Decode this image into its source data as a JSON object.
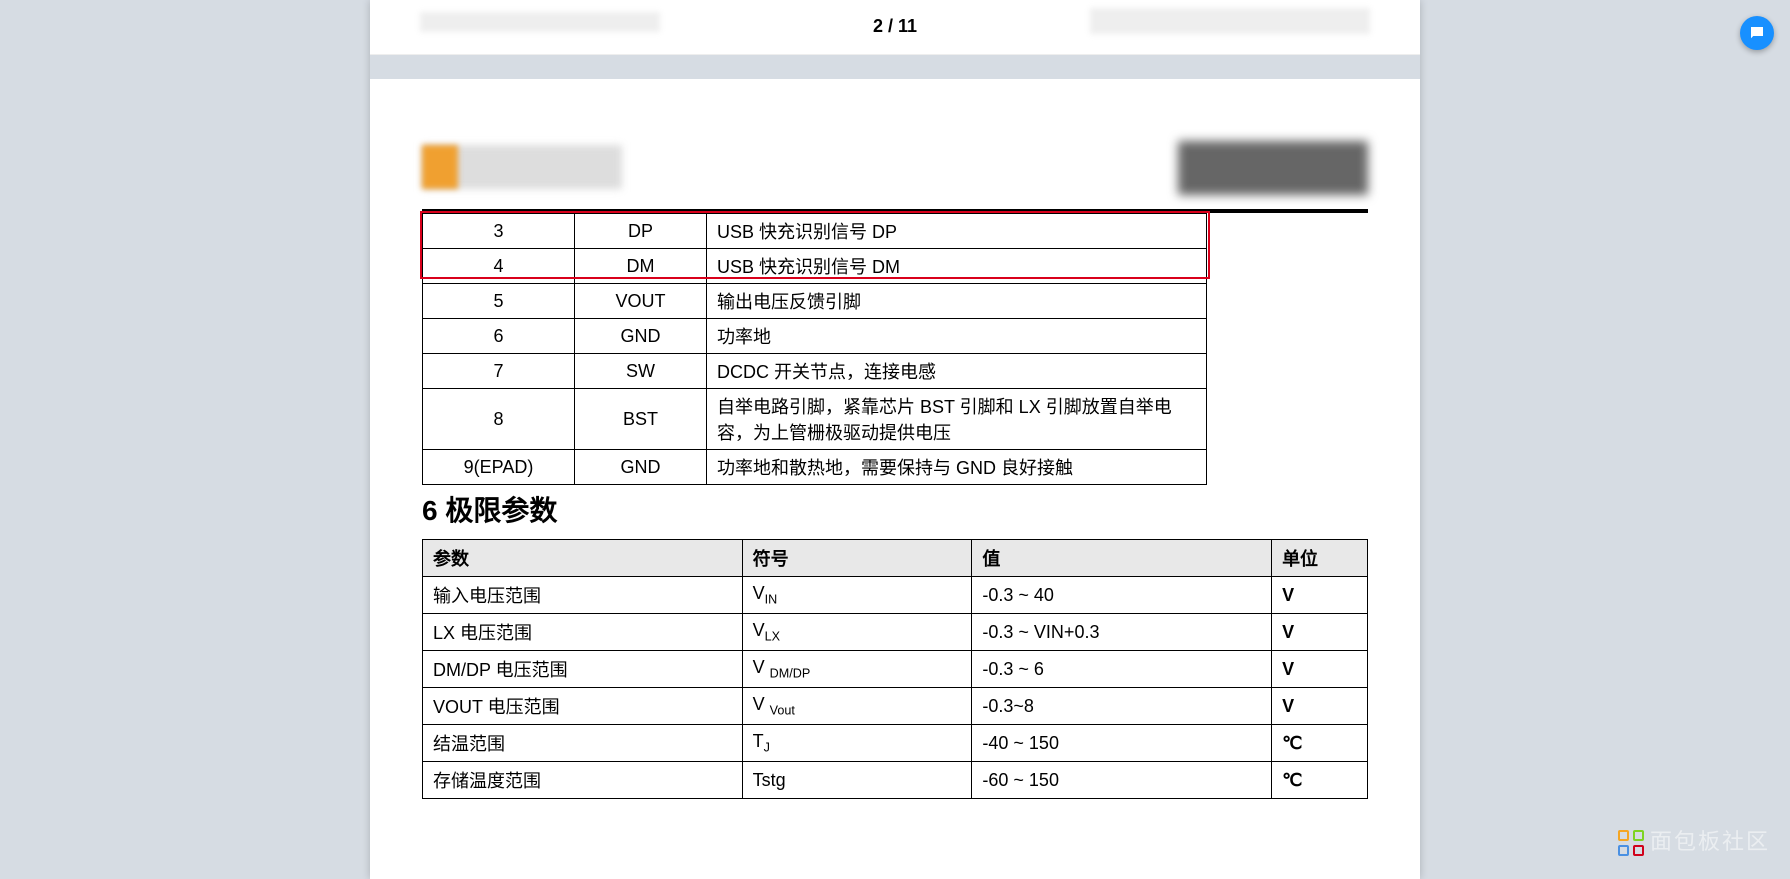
{
  "pager": "2 / 11",
  "pin_rows": [
    {
      "num": "3",
      "name": "DP",
      "desc": "USB 快充识别信号 DP"
    },
    {
      "num": "4",
      "name": "DM",
      "desc": "USB 快充识别信号 DM"
    },
    {
      "num": "5",
      "name": "VOUT",
      "desc": "输出电压反馈引脚"
    },
    {
      "num": "6",
      "name": "GND",
      "desc": "功率地"
    },
    {
      "num": "7",
      "name": "SW",
      "desc": "DCDC 开关节点，连接电感"
    },
    {
      "num": "8",
      "name": "BST",
      "desc": "自举电路引脚，紧靠芯片 BST 引脚和 LX 引脚放置自举电容，为上管栅极驱动提供电压"
    },
    {
      "num": "9(EPAD)",
      "name": "GND",
      "desc": "功率地和散热地，需要保持与 GND 良好接触"
    }
  ],
  "section6": "6  极限参数",
  "param_headers": {
    "p": "参数",
    "s": "符号",
    "v": "值",
    "u": "单位"
  },
  "param_rows": [
    {
      "p": "输入电压范围",
      "s": "V",
      "sub": "IN",
      "v": "-0.3 ~ 40",
      "u": "V"
    },
    {
      "p": "LX 电压范围",
      "s": "V",
      "sub": "LX",
      "v": "-0.3 ~ VIN+0.3",
      "u": "V"
    },
    {
      "p": "DM/DP 电压范围",
      "s": "V ",
      "sub": "DM/DP",
      "v": "-0.3 ~ 6",
      "u": "V"
    },
    {
      "p": "VOUT 电压范围",
      "s": "V ",
      "sub": "Vout",
      "v": "-0.3~8",
      "u": "V"
    },
    {
      "p": "结温范围",
      "s": "T",
      "sub": "J",
      "v": "-40 ~ 150",
      "u": "℃"
    },
    {
      "p": "存储温度范围",
      "s": "Tstg",
      "sub": "",
      "v": "-60 ~ 150",
      "u": "℃"
    }
  ],
  "watermark": "面包板社区"
}
